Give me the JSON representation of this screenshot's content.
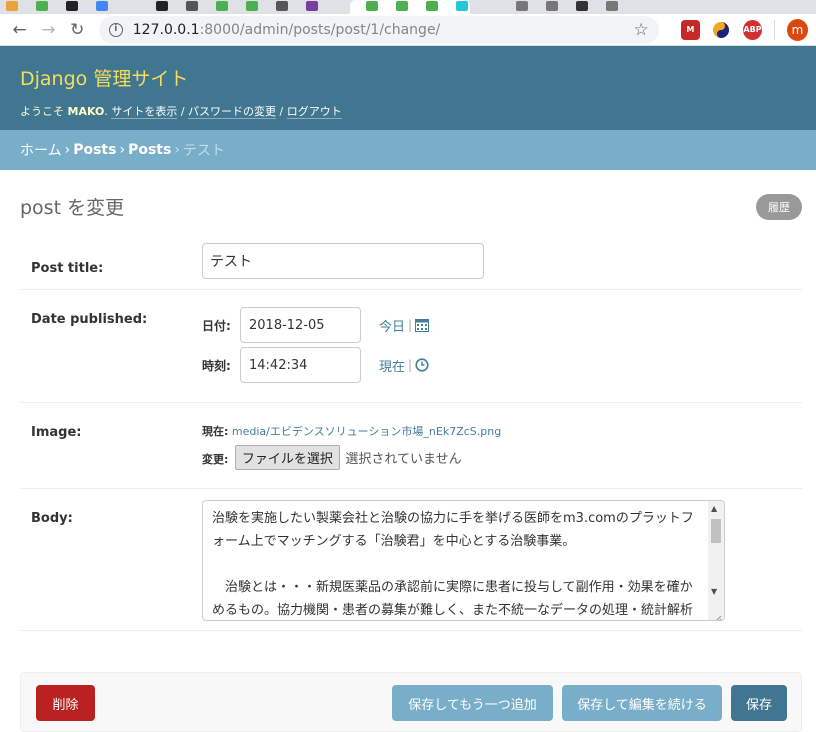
{
  "browser": {
    "url_host": "127.0.0.1",
    "url_path": ":8000/admin/posts/post/1/change/",
    "profile_initial": "m",
    "ext_abp": "ABP",
    "ext_m": "M"
  },
  "header": {
    "branding": "Django 管理サイト",
    "welcome": "ようこそ",
    "username": "MAKO",
    "view_site": "サイトを表示",
    "change_password": "パスワードの変更",
    "logout": "ログアウト",
    "separator": " / "
  },
  "breadcrumbs": {
    "home": "ホーム",
    "app": "Posts",
    "model": "Posts",
    "current": "テスト",
    "sep": "›"
  },
  "page": {
    "title": "post を変更",
    "history_button": "履歴"
  },
  "form": {
    "post_title_label": "Post title:",
    "post_title_value": "テスト",
    "date_published_label": "Date published:",
    "date_label": "日付:",
    "date_value": "2018-12-05",
    "today_link": "今日",
    "time_label": "時刻:",
    "time_value": "14:42:34",
    "now_link": "現在",
    "shortcut_sep": "|",
    "image_label": "Image:",
    "image_current_label": "現在:",
    "image_current_value": "media/エビデンスソリューション市場_nEk7ZcS.png",
    "image_change_label": "変更:",
    "file_button": "ファイルを選択",
    "no_file_text": "選択されていません",
    "body_label": "Body:",
    "body_value": "治験を実施したい製薬会社と治験の協力に手を挙げる医師をm3.comのプラットフォーム上でマッチングする「治験君」を中心とする治験事業。\n\n　治験とは・・・新規医薬品の承認前に実際に患者に投与して副作用・効果を確かめるもの。協力機関・患者の募集が難しく、また不統一なデータの処理・統計解析が困難。従来、製薬会社が自社で医療機関を募集し治験を実施"
  },
  "submit": {
    "delete": "削除",
    "save_add_another": "保存してもう一つ追加",
    "save_continue": "保存して編集を続ける",
    "save": "保存"
  },
  "colors": {
    "header_bg": "#417690",
    "breadcrumb_bg": "#79aec8",
    "branding": "#f5dd5d",
    "delete": "#ba2121",
    "link": "#447e9b"
  }
}
